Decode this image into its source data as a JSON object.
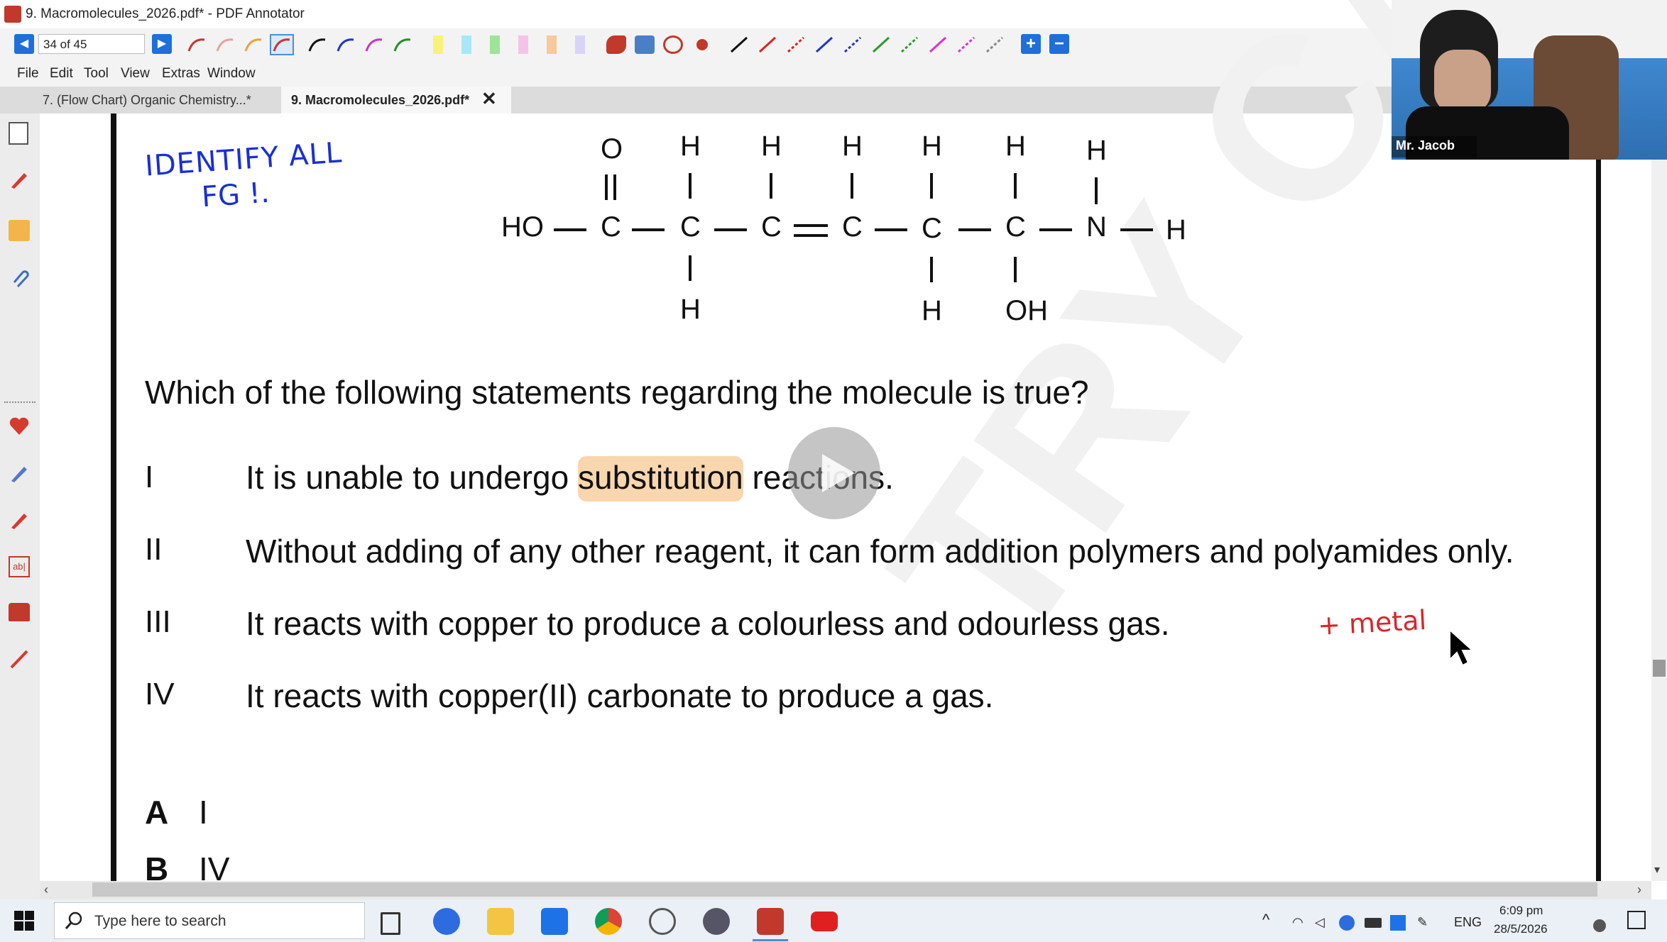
{
  "window": {
    "title": "9. Macromolecules_2026.pdf* - PDF Annotator"
  },
  "toolbar": {
    "page_indicator": "34 of 45",
    "prev_icon": "arrow-left-icon",
    "next_icon": "arrow-right-icon",
    "zoom_in_icon": "plus-icon",
    "zoom_out_icon": "minus-icon"
  },
  "menu": [
    "File",
    "Edit",
    "Tool",
    "View",
    "Extras",
    "Window"
  ],
  "tabs": [
    {
      "label": "7. (Flow Chart) Organic Chemistry...*"
    },
    {
      "label": "9. Macromolecules_2026.pdf*"
    }
  ],
  "video": {
    "name": "Mr. Jacob"
  },
  "annotations": {
    "handwriting_1": "IDENTIFY ALL",
    "handwriting_2": "FG !.",
    "red_note": "+ metal"
  },
  "molecule": {
    "ho": "HO",
    "o": "O",
    "c": "C",
    "h": "H",
    "n": "N",
    "oh": "OH"
  },
  "question": {
    "stem": "Which of the following statements regarding the molecule is true?",
    "statements": [
      {
        "num": "I",
        "before": "It is unable to undergo ",
        "highlight": "substitution",
        "after": " reactions."
      },
      {
        "num": "II",
        "text": "Without adding of any other reagent, it can form addition polymers and polyamides only."
      },
      {
        "num": "III",
        "text": "It reacts with copper to produce a colourless and odourless gas."
      },
      {
        "num": "IV",
        "text": "It reacts with copper(II) carbonate to produce a gas."
      }
    ],
    "options": [
      {
        "letter": "A",
        "value": "I"
      },
      {
        "letter": "B",
        "value": "IV"
      }
    ]
  },
  "taskbar": {
    "search_placeholder": "Type here to search",
    "language": "ENG",
    "time": "6:09 pm",
    "date": "28/5/2026"
  },
  "colors": {
    "highlight": "#f8d6ae",
    "handwriting_blue": "#1a2fd6",
    "handwriting_red": "#d9262c",
    "accent_blue": "#1e6fd9"
  }
}
